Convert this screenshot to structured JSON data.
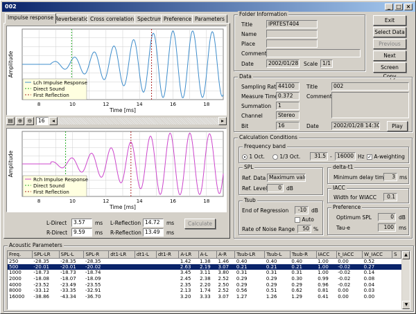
{
  "window": {
    "title": "002"
  },
  "tabs": [
    "Impulse response",
    "Reverberation",
    "Cross correlation",
    "Spectrum",
    "Preference",
    "Parameters"
  ],
  "plot_top": {
    "ylabel": "Amplitude",
    "xlabel": "Time [ms]",
    "xticks": [
      "8",
      "10",
      "12",
      "14",
      "16",
      "18"
    ],
    "legend": [
      "Lch Impulse Response",
      "Direct Sound",
      "First Reflection"
    ]
  },
  "plot_bottom": {
    "ylabel": "Amplitude",
    "xlabel": "Time [ms]",
    "xticks": [
      "8",
      "10",
      "12",
      "14",
      "16",
      "18"
    ],
    "legend": [
      "Rch Impulse Response",
      "Direct Sound",
      "First Reflection"
    ]
  },
  "colors": {
    "lch": "#3c8ccb",
    "rch": "#cc44cc",
    "direct": "#22aa22",
    "reflection": "#aa2222",
    "selection": "#0a246a"
  },
  "scroll_value": "16",
  "measures": {
    "l_direct_label": "L-Direct",
    "l_direct": "3.57",
    "r_direct_label": "R-Direct",
    "r_direct": "9.59",
    "l_reflection_label": "L-Reflection",
    "l_reflection": "14.72",
    "r_reflection_label": "R-Reflection",
    "r_reflection": "13.49",
    "unit": "ms",
    "calculate": "Calculate"
  },
  "folder": {
    "group": "Folder Information",
    "title_label": "Title",
    "title": "IPRTEST404",
    "name_label": "Name",
    "name": "",
    "place_label": "Place",
    "place": "",
    "comment_label": "Comment",
    "comment": "",
    "date_label": "Date",
    "date": "2002/01/28",
    "scale_label": "Scale",
    "scale": "1/1"
  },
  "buttons": {
    "exit": "Exit",
    "select_data": "Select Data",
    "previous": "Previous",
    "next": "Next",
    "screen_copy": "Screen Copy",
    "play": "Play"
  },
  "data": {
    "group": "Data",
    "sampling_rate_label": "Sampling Rate",
    "sampling_rate": "44100",
    "measure_time_label": "Measure Time",
    "measure_time": "0.372",
    "summation_label": "Summation",
    "summation": "1",
    "channel_label": "Channel",
    "channel": "Stereo",
    "bit_label": "Bit",
    "bit": "16",
    "title_label": "Title",
    "title": "002",
    "comment_label": "Comment",
    "comment": "",
    "date_label": "Date",
    "date": "2002/01/28 14:30:41"
  },
  "calc": {
    "group": "Calculation Conditions",
    "freq_group": "Frequency band",
    "oct1": "1 Oct.",
    "oct3": "1/3 Oct.",
    "freq_from": "31.5",
    "freq_to": "16000",
    "freq_unit": "Hz",
    "aweight": "A-weighting",
    "spl_group": "SPL",
    "ref_data_label": "Ref. Data",
    "ref_data": "Maximum value",
    "ref_level_label": "Ref. Level",
    "ref_level": "0",
    "ref_level_unit": "dB",
    "deltat_group": "delta-t1",
    "min_delay_label": "Minimum delay time",
    "min_delay": "3",
    "min_delay_unit": "ms",
    "tsub_group": "Tsub",
    "end_reg_label": "End of Regression",
    "end_reg": "-10",
    "end_reg_unit": "dB",
    "auto": "Auto",
    "noise_label": "Rate of Noise Range",
    "noise": "50",
    "noise_unit": "%",
    "iacc_group": "IACC",
    "wiacc_label": "Width for WIACC",
    "wiacc": "0.1",
    "pref_group": "Preference",
    "opt_spl_label": "Optimum SPL",
    "opt_spl": "0",
    "opt_spl_unit": "dB",
    "taue_label": "Tau-e",
    "taue": "100",
    "taue_unit": "ms"
  },
  "acoustic": {
    "group": "Acoustic Parameters",
    "columns": [
      "Freq.",
      "SPL-LR",
      "SPL-L",
      "SPL-R",
      "dt1-LR",
      "dt1-L",
      "dt1-R",
      "A-LR",
      "A-L",
      "A-R",
      "Tsub-LR",
      "Tsub-L",
      "Tsub-R",
      "IACC",
      "t_IACC",
      "W_IACC",
      "S"
    ],
    "rows": [
      [
        "250",
        "-28.35",
        "-28.35",
        "-28.35",
        "",
        "",
        "",
        "1.42",
        "1.38",
        "1.46",
        "0.40",
        "0.40",
        "0.40",
        "1.00",
        "0.00",
        "0.52",
        ""
      ],
      [
        "500",
        "-20.01",
        "-20.01",
        "-20.02",
        "",
        "",
        "",
        "2.63",
        "2.19",
        "3.07",
        "0.21",
        "0.21",
        "0.21",
        "1.00",
        "-0.02",
        "0.27",
        ""
      ],
      [
        "1000",
        "-18.73",
        "-18.73",
        "-18.74",
        "",
        "",
        "",
        "3.45",
        "3.11",
        "3.80",
        "0.31",
        "0.31",
        "0.31",
        "1.00",
        "-0.02",
        "0.14",
        ""
      ],
      [
        "2000",
        "-18.08",
        "-18.07",
        "-18.09",
        "",
        "",
        "",
        "2.45",
        "2.38",
        "2.52",
        "0.29",
        "0.29",
        "0.30",
        "0.99",
        "-0.02",
        "0.08",
        ""
      ],
      [
        "4000",
        "-23.52",
        "-23.49",
        "-23.55",
        "",
        "",
        "",
        "2.35",
        "2.20",
        "2.50",
        "0.29",
        "0.29",
        "0.29",
        "0.96",
        "-0.02",
        "0.04",
        ""
      ],
      [
        "8000",
        "-33.12",
        "-33.35",
        "-32.91",
        "",
        "",
        "",
        "2.13",
        "1.74",
        "2.52",
        "0.56",
        "0.51",
        "0.62",
        "0.81",
        "0.00",
        "0.03",
        ""
      ],
      [
        "16000",
        "-38.86",
        "-43.34",
        "-36.70",
        "",
        "",
        "",
        "3.20",
        "3.33",
        "3.07",
        "1.27",
        "1.26",
        "1.29",
        "0.41",
        "0.00",
        "0.00",
        ""
      ]
    ],
    "selected_row": 1
  }
}
